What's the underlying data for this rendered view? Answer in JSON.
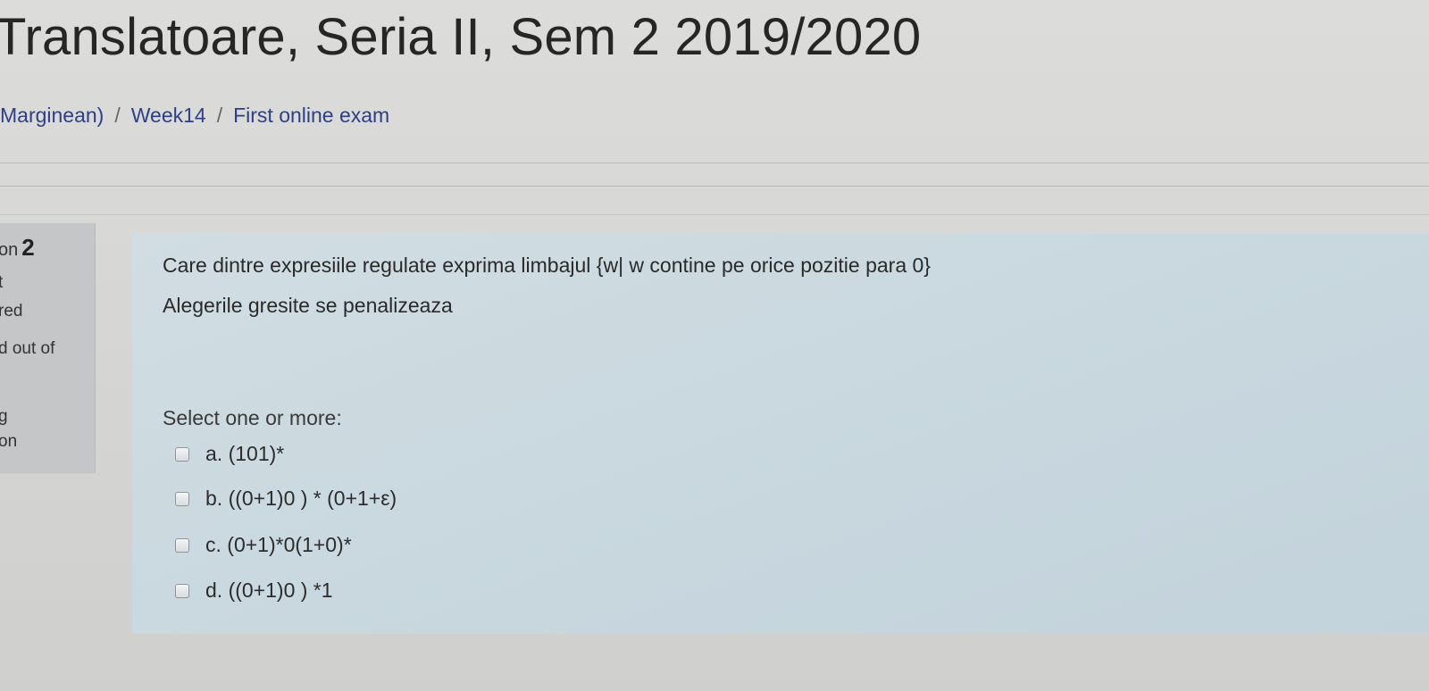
{
  "header": {
    "title": "Translatoare, Seria II, Sem 2 2019/2020"
  },
  "breadcrumb": {
    "items": [
      {
        "label": "Marginean)"
      },
      {
        "label": "Week14"
      },
      {
        "label": "First online exam"
      }
    ],
    "separator": "/"
  },
  "question_info": {
    "question_prefix": "on",
    "question_number": "2",
    "line2": "t",
    "line3": "red",
    "line4": "d out of",
    "line5": "g",
    "line6": "on"
  },
  "question": {
    "text": "Care dintre expresiile regulate exprima limbajul {w| w contine pe orice pozitie para 0}",
    "note": "Alegerile gresite se penalizeaza",
    "prompt": "Select one or more:",
    "answers": [
      {
        "label": "a. (101)*",
        "checked": false
      },
      {
        "label": "b. ((0+1)0 ) * (0+1+ε)",
        "checked": false
      },
      {
        "label": "c. (0+1)*0(1+0)*",
        "checked": false
      },
      {
        "label": "d. ((0+1)0 ) *1",
        "checked": false
      }
    ]
  },
  "colors": {
    "content_background": "#c9d8df",
    "info_background": "#c4c6c7",
    "link": "#2f3f85"
  }
}
